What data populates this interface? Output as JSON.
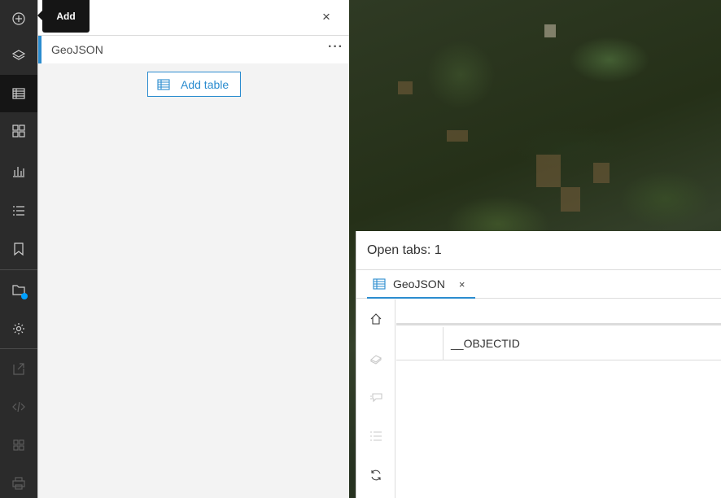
{
  "tooltip": {
    "text": "Add"
  },
  "actionbar": {
    "items": [
      {
        "name": "add",
        "icon": "plus-circle-icon"
      },
      {
        "name": "layers",
        "icon": "layers-icon"
      },
      {
        "name": "tables",
        "icon": "table-icon",
        "active": true
      },
      {
        "name": "legend",
        "icon": "grid-icon"
      },
      {
        "name": "charts",
        "icon": "bar-chart-icon"
      },
      {
        "name": "list",
        "icon": "list-icon"
      },
      {
        "name": "bookmarks",
        "icon": "bookmark-icon"
      },
      {
        "name": "folder",
        "icon": "folder-icon",
        "badge_color": "#00a0ff"
      },
      {
        "name": "settings",
        "icon": "gear-icon"
      },
      {
        "name": "export",
        "icon": "export-icon",
        "disabled": true
      },
      {
        "name": "embed",
        "icon": "code-icon",
        "disabled": true
      },
      {
        "name": "apps",
        "icon": "apps-grid-icon",
        "disabled": true
      },
      {
        "name": "print",
        "icon": "print-icon",
        "disabled": true
      }
    ]
  },
  "panel": {
    "close_label": "×",
    "layer": {
      "name": "GeoJSON",
      "more_label": "···"
    },
    "add_table_label": "Add table"
  },
  "table_panel": {
    "title": "Open tabs: 1",
    "tab": {
      "label": "GeoJSON",
      "close_label": "×"
    },
    "columns": [
      "__OBJECTID"
    ],
    "side_tools": [
      {
        "name": "home",
        "icon": "home-icon"
      },
      {
        "name": "clear-selection",
        "icon": "eraser-icon",
        "disabled": true
      },
      {
        "name": "filter",
        "icon": "filter-icon",
        "disabled": true
      },
      {
        "name": "show-list",
        "icon": "list-icon",
        "disabled": true
      },
      {
        "name": "refresh",
        "icon": "refresh-icon"
      }
    ]
  },
  "colors": {
    "accent": "#2b8ccf",
    "actionbar_bg": "#2b2b2b",
    "active_bg": "#151515"
  }
}
